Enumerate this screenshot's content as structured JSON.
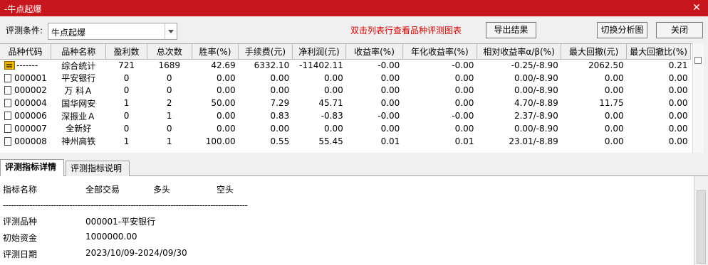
{
  "window": {
    "title": "-牛点起爆",
    "close_glyph": "✕"
  },
  "toolbar": {
    "condition_label": "评测条件:",
    "condition_value": "牛点起爆",
    "hint": "双击列表行查看品种评测图表",
    "export_label": "导出结果",
    "switch_label": "切换分析图",
    "close_label": "关闭"
  },
  "table": {
    "columns": [
      "品种代码",
      "品种名称",
      "盈利数",
      "总次数",
      "胜率(%)",
      "手续费(元)",
      "净利润(元)",
      "收益率(%)",
      "年化收益率(%)",
      "相对收益率α/β(%)",
      "最大回撤(元)",
      "最大回撤比(%)"
    ],
    "rows": [
      {
        "icon": "summary-icon",
        "code": "-------",
        "name": "综合统计",
        "wins": "721",
        "total": "1689",
        "winrate": "42.69",
        "fee": "6332.10",
        "profit": "-11402.11",
        "ret": "-0.00",
        "annual": "-0.00",
        "relative": "-0.25/-8.90",
        "maxdd": "2062.50",
        "maxddr": "0.21"
      },
      {
        "icon": "document-icon",
        "code": "000001",
        "name": "平安银行",
        "wins": "0",
        "total": "0",
        "winrate": "0.00",
        "fee": "0.00",
        "profit": "0.00",
        "ret": "0.00",
        "annual": "0.00",
        "relative": "0.00/-8.90",
        "maxdd": "0.00",
        "maxddr": "0.00"
      },
      {
        "icon": "document-icon",
        "code": "000002",
        "name": "万 科Ａ",
        "wins": "0",
        "total": "0",
        "winrate": "0.00",
        "fee": "0.00",
        "profit": "0.00",
        "ret": "0.00",
        "annual": "0.00",
        "relative": "0.00/-8.90",
        "maxdd": "0.00",
        "maxddr": "0.00"
      },
      {
        "icon": "document-icon",
        "code": "000004",
        "name": "国华网安",
        "wins": "1",
        "total": "2",
        "winrate": "50.00",
        "fee": "7.29",
        "profit": "45.71",
        "ret": "0.00",
        "annual": "0.00",
        "relative": "4.70/-8.89",
        "maxdd": "11.75",
        "maxddr": "0.00"
      },
      {
        "icon": "document-icon",
        "code": "000006",
        "name": "深振业Ａ",
        "wins": "0",
        "total": "1",
        "winrate": "0.00",
        "fee": "0.83",
        "profit": "-0.83",
        "ret": "-0.00",
        "annual": "-0.00",
        "relative": "2.37/-8.90",
        "maxdd": "0.00",
        "maxddr": "0.00"
      },
      {
        "icon": "document-icon",
        "code": "000007",
        "name": "全新好",
        "wins": "0",
        "total": "0",
        "winrate": "0.00",
        "fee": "0.00",
        "profit": "0.00",
        "ret": "0.00",
        "annual": "0.00",
        "relative": "0.00/-8.90",
        "maxdd": "0.00",
        "maxddr": "0.00"
      },
      {
        "icon": "document-icon",
        "code": "000008",
        "name": "神州高铁",
        "wins": "1",
        "total": "1",
        "winrate": "100.00",
        "fee": "0.55",
        "profit": "55.45",
        "ret": "0.01",
        "annual": "0.01",
        "relative": "23.01/-8.89",
        "maxdd": "0.00",
        "maxddr": "0.00"
      }
    ]
  },
  "tabs": [
    {
      "label": "评测指标详情",
      "active": true
    },
    {
      "label": "评测指标说明",
      "active": false
    }
  ],
  "detail": {
    "header": {
      "name": "指标名称",
      "all": "全部交易",
      "long": "多头",
      "short": "空头"
    },
    "separator": "--------------------------------------------------------------------------------------------",
    "lines": [
      {
        "label": "评测品种",
        "value": "000001-平安银行"
      },
      {
        "label": "初始资金",
        "value": "1000000.00"
      },
      {
        "label": "评测日期",
        "value": "2023/10/09-2024/09/30"
      }
    ]
  }
}
